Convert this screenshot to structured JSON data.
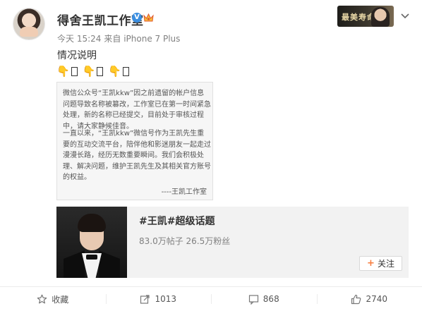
{
  "post": {
    "username": "得舍王凯工作室",
    "verified_badge": "V",
    "meta": {
      "time": "今天 15:24",
      "source": "来自 iPhone 7 Plus"
    },
    "text": "情况说明",
    "emoji_row": [
      "hand-down",
      "box",
      "hand-down",
      "box",
      "hand-down",
      "box"
    ]
  },
  "image_card": {
    "paragraph1": "微信公众号“王凯kkw”因之前遗留的帐户信息问题导致名称被篡改，工作室已在第一时间紧急处理，新的名称已经提交，目前处于审核过程中，请大家静候佳音。",
    "paragraph2": "一直以来，“王凯kkw”微信号作为王凯先生重要的互动交流平台，陪伴他和影迷朋友一起走过漫漫长路，经历无数重要瞬间。我们会积极处理、解决问题，维护王凯先生及其相关官方账号的权益。",
    "signature": "----王凯工作室"
  },
  "topic_card": {
    "title": "#王凯#超级话题",
    "stats": "83.0万帖子 26.5万粉丝",
    "follow_label": "关注"
  },
  "actions": {
    "favorite": "收藏",
    "repost": "1013",
    "comment": "868",
    "like": "2740"
  },
  "colors": {
    "accent": "#f77c3d",
    "verified": "#3b8ee0",
    "meta_text": "#808080"
  }
}
